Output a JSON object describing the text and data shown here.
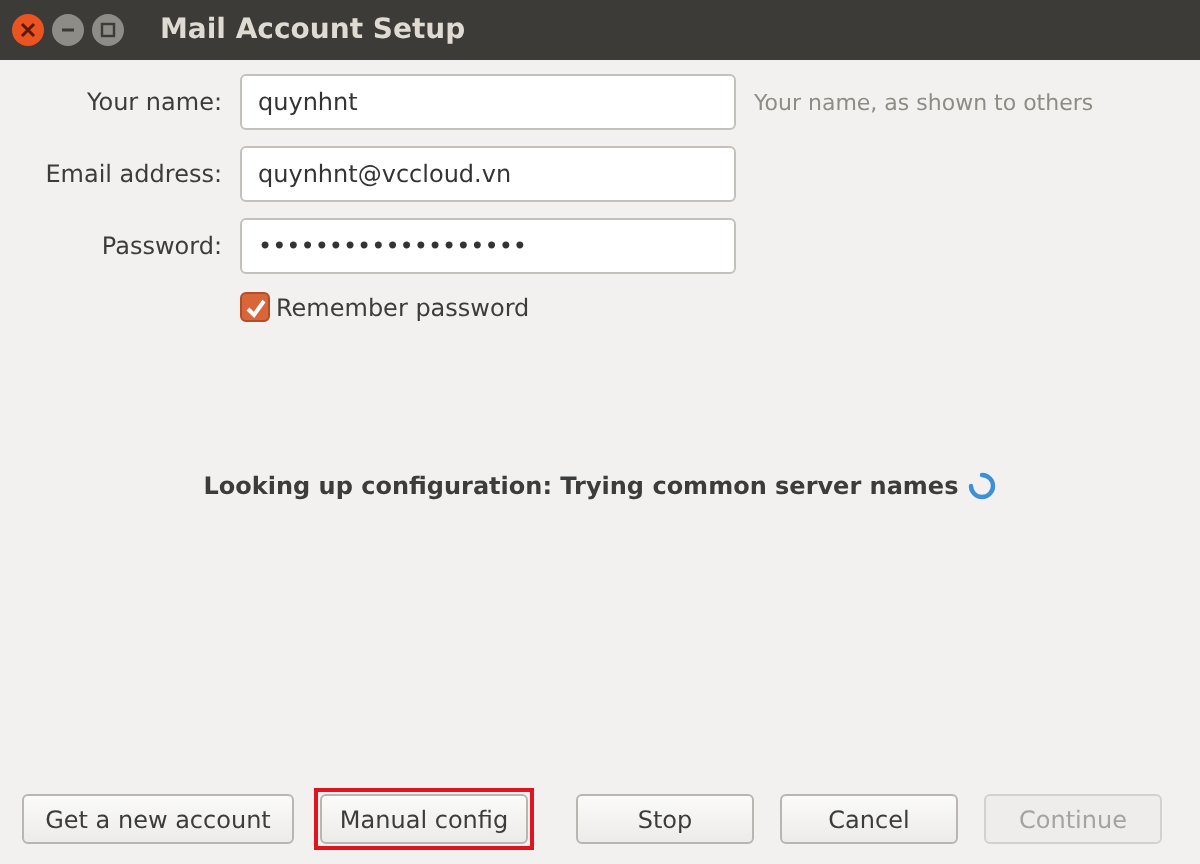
{
  "window": {
    "title": "Mail Account Setup"
  },
  "fields": [
    {
      "label": "Your name:",
      "value": "quynhnt",
      "hint": "Your name, as shown to others"
    },
    {
      "label": "Email address:",
      "value": "quynhnt@vccloud.vn"
    },
    {
      "label": "Password:",
      "value": "•••••••••••••••••••"
    }
  ],
  "remember": {
    "label": "Remember password",
    "checked": true
  },
  "status": {
    "text": "Looking up configuration: Trying common server names",
    "busy": true
  },
  "buttons": [
    {
      "label": "Get a new account",
      "disabled": false,
      "highlighted": false
    },
    {
      "label": "Manual config",
      "disabled": false,
      "highlighted": true
    },
    {
      "label": "Stop",
      "disabled": false,
      "highlighted": false
    },
    {
      "label": "Cancel",
      "disabled": false,
      "highlighted": false
    },
    {
      "label": "Continue",
      "disabled": true,
      "highlighted": false
    }
  ]
}
